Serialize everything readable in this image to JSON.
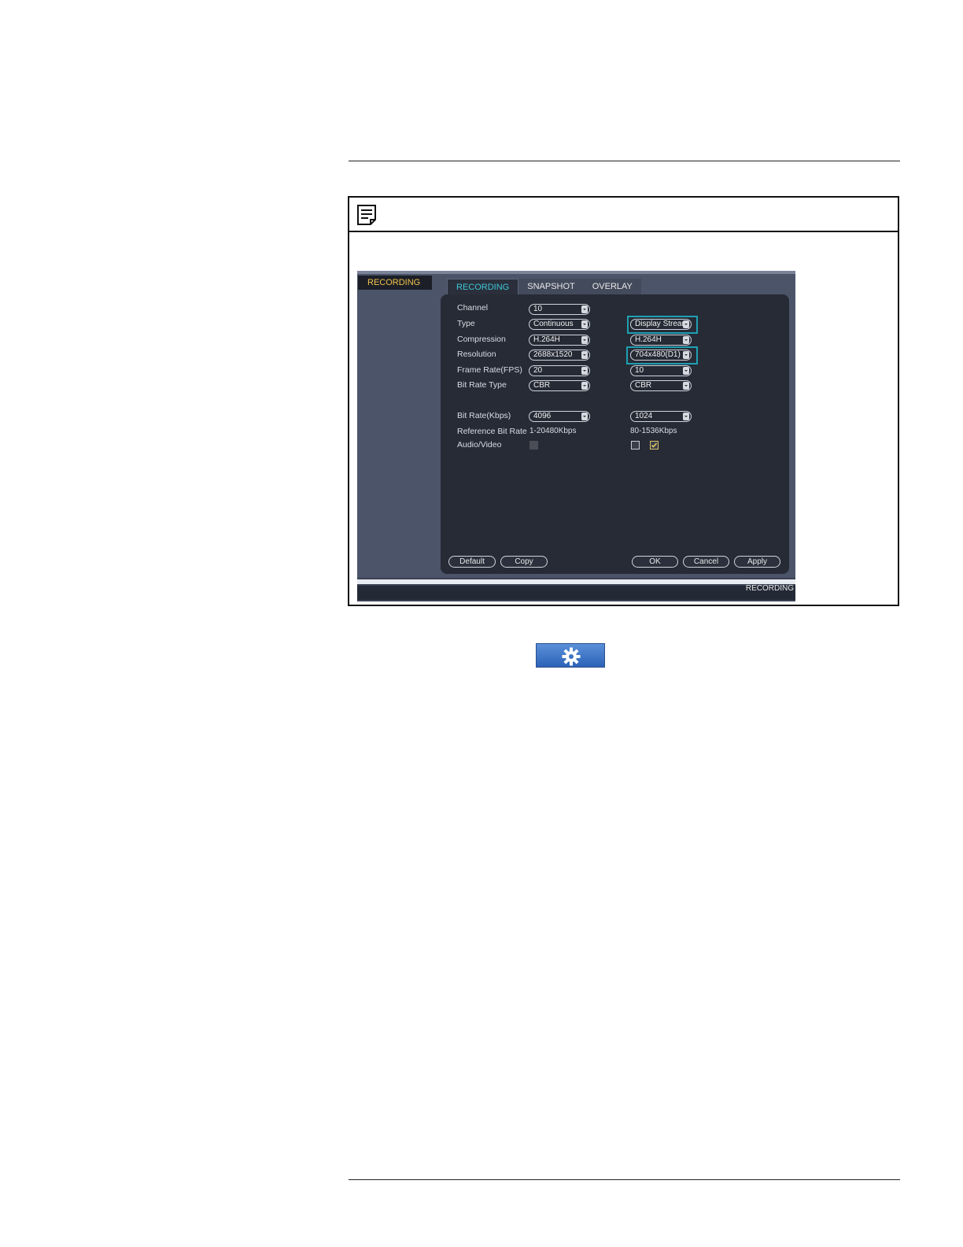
{
  "screenshot": {
    "sidebar_item": "RECORDING",
    "tabs": [
      {
        "label": "RECORDING",
        "active": true
      },
      {
        "label": "SNAPSHOT",
        "active": false
      },
      {
        "label": "OVERLAY",
        "active": false
      }
    ],
    "rows": [
      {
        "label": "Channel",
        "main": "10"
      },
      {
        "label": "Type",
        "main": "Continuous",
        "sub": "Display Strear"
      },
      {
        "label": "Compression",
        "main": "H.264H",
        "sub": "H.264H"
      },
      {
        "label": "Resolution",
        "main": "2688x1520",
        "sub": "704x480(D1)"
      },
      {
        "label": "Frame Rate(FPS)",
        "main": "20",
        "sub": "10"
      },
      {
        "label": "Bit Rate Type",
        "main": "CBR",
        "sub": "CBR"
      },
      {
        "label": "Bit Rate(Kbps)",
        "main": "4096",
        "sub": "1024"
      }
    ],
    "reference": {
      "label": "Reference Bit Rate",
      "main": "1-20480Kbps",
      "sub": "80-1536Kbps"
    },
    "audio_video": {
      "label": "Audio/Video",
      "main_checked": false,
      "sub_checked_1": false,
      "sub_checked_2": true
    },
    "buttons": {
      "default": "Default",
      "copy": "Copy",
      "ok": "OK",
      "cancel": "Cancel",
      "apply": "Apply"
    },
    "bottom_label": "RECORDING",
    "colors": {
      "highlight": "#1fa0b4",
      "tab_active": "#3fc6d6",
      "sidebar_text": "#f0c24a"
    }
  },
  "icons": {
    "note": "note-icon",
    "settings": "gear-icon"
  }
}
